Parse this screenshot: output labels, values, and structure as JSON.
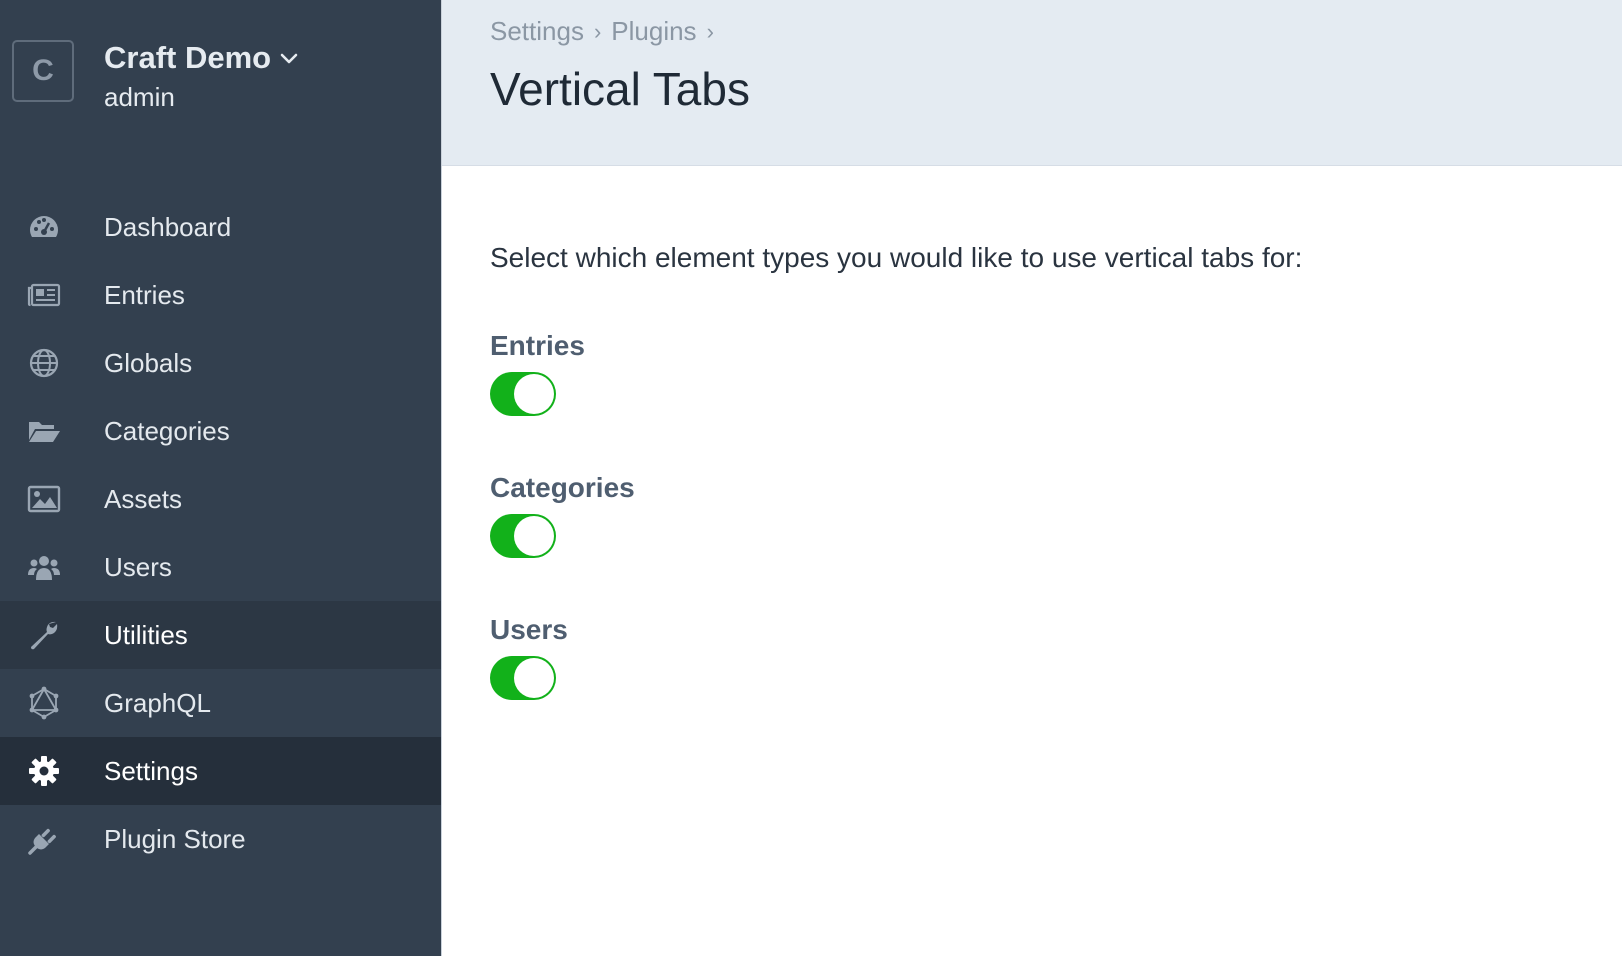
{
  "site": {
    "logo_letter": "C",
    "name": "Craft Demo",
    "user": "admin"
  },
  "nav": {
    "items": [
      {
        "label": "Dashboard",
        "icon": "dashboard-icon"
      },
      {
        "label": "Entries",
        "icon": "newspaper-icon"
      },
      {
        "label": "Globals",
        "icon": "globe-icon"
      },
      {
        "label": "Categories",
        "icon": "folder-open-icon"
      },
      {
        "label": "Assets",
        "icon": "image-icon"
      },
      {
        "label": "Users",
        "icon": "users-icon"
      },
      {
        "label": "Utilities",
        "icon": "wrench-icon",
        "state": "hover"
      },
      {
        "label": "GraphQL",
        "icon": "graphql-icon"
      },
      {
        "label": "Settings",
        "icon": "gear-icon",
        "state": "active"
      },
      {
        "label": "Plugin Store",
        "icon": "plug-icon"
      }
    ]
  },
  "breadcrumb": {
    "items": [
      "Settings",
      "Plugins"
    ],
    "separator": "›"
  },
  "page": {
    "title": "Vertical Tabs",
    "instructions": "Select which element types you would like to use vertical tabs for:"
  },
  "fields": [
    {
      "label": "Entries",
      "enabled": true
    },
    {
      "label": "Categories",
      "enabled": true
    },
    {
      "label": "Users",
      "enabled": true
    }
  ],
  "colors": {
    "sidebar_bg": "#33404f",
    "header_bg": "#e4ebf2",
    "toggle_on": "#12b11a"
  }
}
